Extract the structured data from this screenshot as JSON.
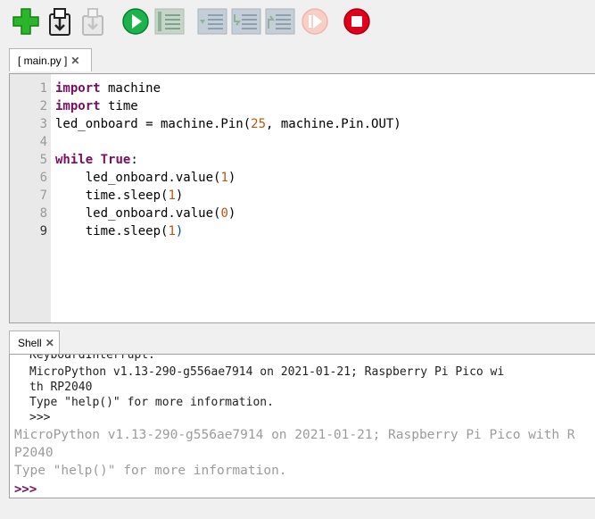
{
  "toolbar": {
    "buttons": [
      {
        "icon": "new-file-icon",
        "state": "enabled"
      },
      {
        "icon": "open-file-icon",
        "state": "enabled"
      },
      {
        "icon": "save-file-icon",
        "state": "disabled"
      },
      {
        "icon": "run-icon",
        "state": "enabled"
      },
      {
        "icon": "debug-icon",
        "state": "disabled"
      },
      {
        "icon": "step-over-icon",
        "state": "disabled"
      },
      {
        "icon": "step-into-icon",
        "state": "disabled"
      },
      {
        "icon": "step-out-icon",
        "state": "disabled"
      },
      {
        "icon": "resume-icon",
        "state": "disabled"
      },
      {
        "icon": "stop-icon",
        "state": "enabled"
      }
    ]
  },
  "editor": {
    "tab_label": "[ main.py ]",
    "close_glyph": "✕",
    "current_line": 9,
    "line_numbers": [
      "1",
      "2",
      "3",
      "4",
      "5",
      "6",
      "7",
      "8",
      "9"
    ],
    "lines": [
      "import machine",
      "import time",
      "led_onboard = machine.Pin(25, machine.Pin.OUT)",
      "",
      "while True:",
      "    led_onboard.value(1)",
      "    time.sleep(1)",
      "    led_onboard.value(0)",
      "    time.sleep(1)"
    ],
    "tokens": {
      "import": "import",
      "machine": " machine",
      "time": " time",
      "assign_head": "led_onboard = machine.Pin(",
      "pin_num": "25",
      "assign_tail": ", machine.Pin.OUT)",
      "while": "while",
      "true": "True",
      "colon": ":",
      "indent": "    ",
      "value_call": "led_onboard.value(",
      "sleep_call": "time.sleep(",
      "one": "1",
      "zero": "0",
      "close_paren": ")"
    }
  },
  "shell": {
    "tab_label": "Shell",
    "close_glyph": "✕",
    "history": [
      "KeyboardInterrupt:",
      "MicroPython v1.13-290-g556ae7914 on 2021-01-21; Raspberry Pi Pico wi",
      "th RP2040",
      "Type \"help()\" for more information.",
      ">>>"
    ],
    "latest": [
      "MicroPython v1.13-290-g556ae7914 on 2021-01-21; Raspberry Pi Pico with R",
      "P2040",
      "Type \"help()\" for more information."
    ],
    "prompt": ">>>"
  },
  "colors": {
    "keyword": "#7a0c62",
    "number": "#b8560f",
    "current_line_number": "#333333",
    "run_green": "#1bb34a",
    "stop_red": "#e0001b"
  }
}
